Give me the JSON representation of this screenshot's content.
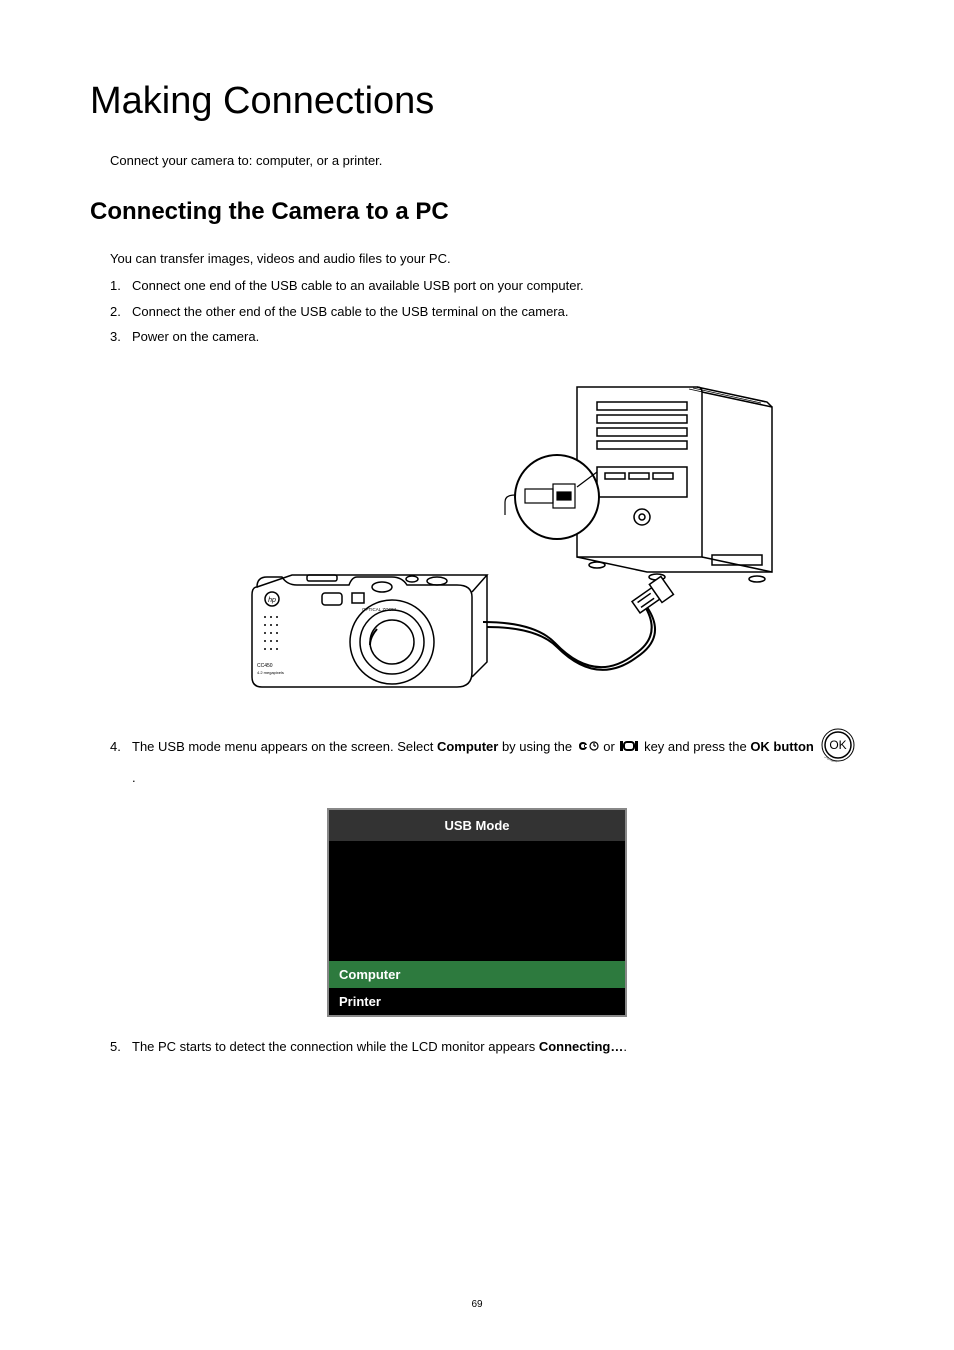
{
  "title": "Making Connections",
  "intro": "Connect your camera to: computer, or a printer.",
  "section_heading": "Connecting the Camera to a PC",
  "section_intro": "You can transfer images, videos and audio files to your PC.",
  "steps": {
    "s1": {
      "num": "1.",
      "text": "Connect one end of the USB cable to an available USB port on your computer."
    },
    "s2": {
      "num": "2.",
      "text": "Connect the other end of the USB cable to the USB terminal on the camera."
    },
    "s3": {
      "num": "3.",
      "text": "Power on the camera."
    },
    "s4": {
      "num": "4.",
      "pre": "The USB mode menu appears on the screen. Select ",
      "bold1": "Computer",
      "mid1": " by using the ",
      "mid2": " or ",
      "mid3": " key and press the ",
      "bold2": "OK button",
      "post": " ."
    },
    "s5": {
      "num": "5.",
      "pre": "The PC starts to detect the connection while the LCD monitor appears ",
      "bold": "Connecting…",
      "post": "."
    }
  },
  "ok_label": "OK",
  "usb_menu": {
    "title": "USB Mode",
    "item_computer": "Computer",
    "item_printer": "Printer"
  },
  "page_number": "69"
}
